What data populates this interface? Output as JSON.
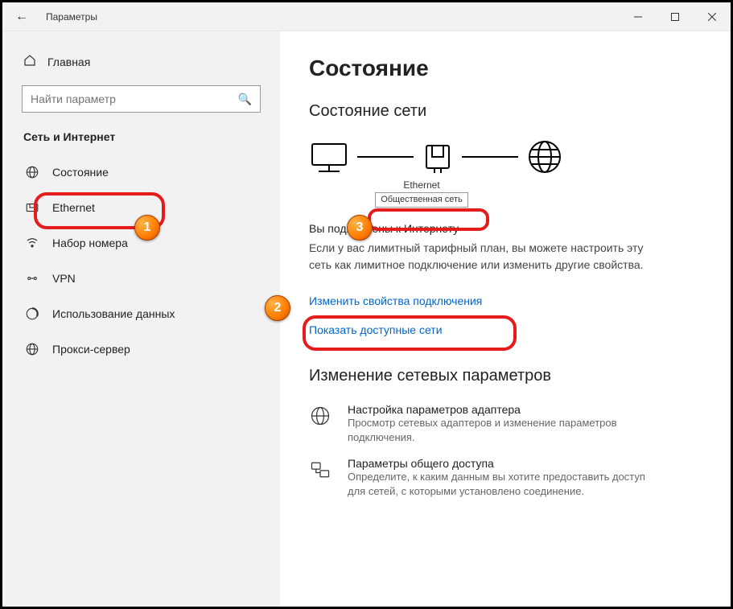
{
  "window": {
    "title": "Параметры"
  },
  "sidebar": {
    "home": "Главная",
    "search_placeholder": "Найти параметр",
    "heading": "Сеть и Интернет",
    "items": [
      {
        "label": "Состояние"
      },
      {
        "label": "Ethernet"
      },
      {
        "label": "Набор номера"
      },
      {
        "label": "VPN"
      },
      {
        "label": "Использование данных"
      },
      {
        "label": "Прокси-сервер"
      }
    ]
  },
  "content": {
    "page_title": "Состояние",
    "section_status": "Состояние сети",
    "diagram": {
      "adapter": "Ethernet",
      "profile": "Общественная сеть"
    },
    "connected_heading": "Вы подключены к Интернету",
    "connected_desc": "Если у вас лимитный тарифный план, вы можете настроить эту сеть как лимитное подключение или изменить другие свойства.",
    "change_props": "Изменить свойства подключения",
    "show_networks": "Показать доступные сети",
    "section_change": "Изменение сетевых параметров",
    "opt_adapter_title": "Настройка параметров адаптера",
    "opt_adapter_desc": "Просмотр сетевых адаптеров и изменение параметров подключения.",
    "opt_sharing_title": "Параметры общего доступа",
    "opt_sharing_desc": "Определите, к каким данным вы хотите предоставить доступ для сетей, с которыми установлено соединение."
  },
  "annotations": {
    "b1": "1",
    "b2": "2",
    "b3": "3"
  }
}
